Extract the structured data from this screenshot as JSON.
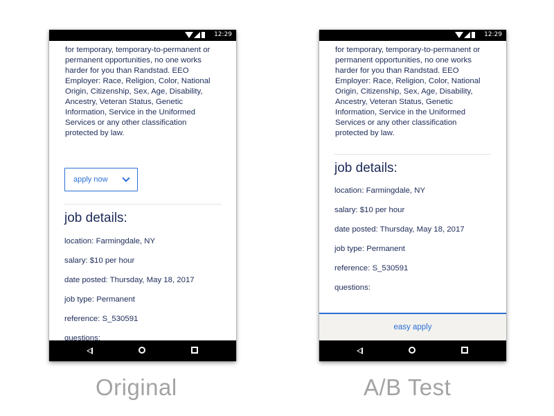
{
  "status_bar": {
    "time": "12:29"
  },
  "description": "for temporary, temporary-to-permanent or permanent opportunities, no one works harder for you than Randstad. EEO Employer: Race, Religion, Color, National Origin, Citizenship, Sex, Age, Disability, Ancestry, Veteran Status, Genetic Information, Service in the Uniformed Services or any other classification protected by law.",
  "apply_button": {
    "label": "apply now"
  },
  "job_details": {
    "heading": "job details:",
    "location": "location: Farmingdale, NY",
    "salary": "salary: $10 per hour",
    "date_posted": "date posted: Thursday, May 18, 2017",
    "job_type": "job type: Permanent",
    "reference": "reference: S_530591",
    "questions": "questions:"
  },
  "easy_apply": {
    "label": "easy apply"
  },
  "captions": {
    "original": "Original",
    "ab_test": "A/B Test"
  },
  "colors": {
    "accent": "#2b6fd6",
    "text": "#1c2a58",
    "caption": "#a3a3a3",
    "bar_bg": "#f3f2ee"
  },
  "icons": [
    "wifi-icon",
    "signal-icon",
    "battery-icon",
    "chevron-down-icon",
    "back-icon",
    "home-icon",
    "recents-icon"
  ]
}
